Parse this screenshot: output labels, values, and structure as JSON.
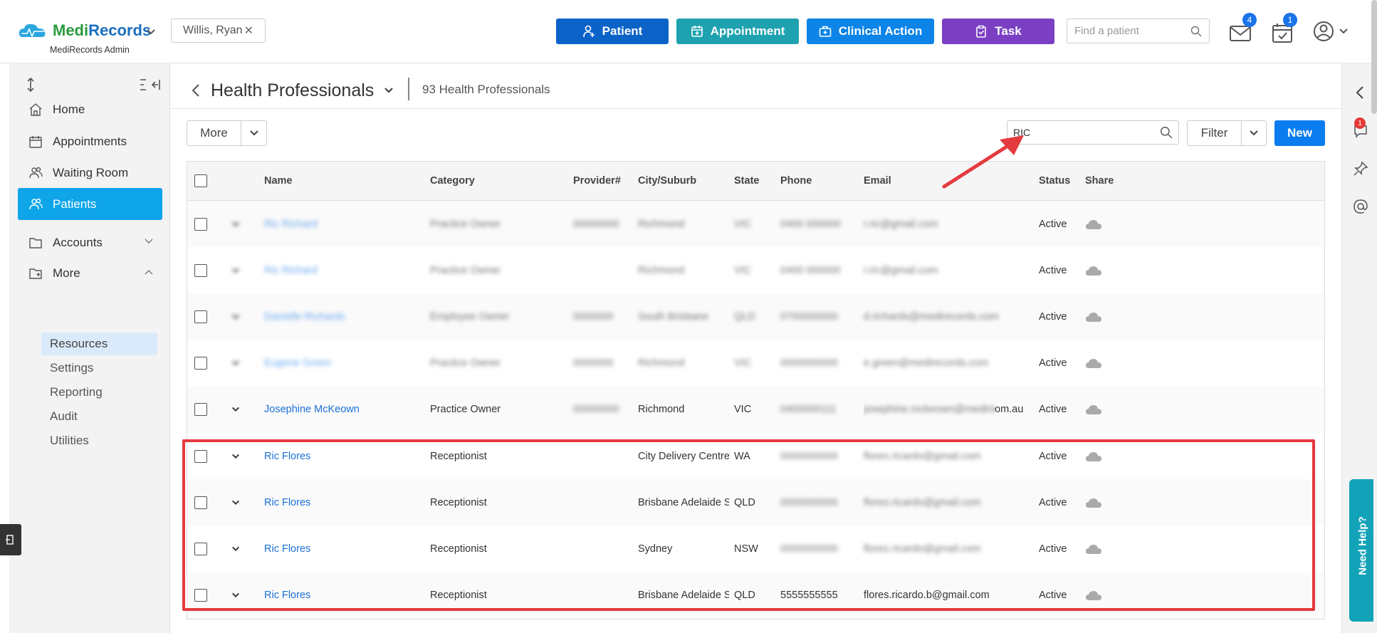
{
  "header": {
    "brand": "MediRecords",
    "brand_sub": "MediRecords Admin",
    "patient_chip": "Willis, Ryan",
    "buttons": {
      "patient": "Patient",
      "appointment": "Appointment",
      "clinical": "Clinical Action",
      "task": "Task"
    },
    "find_placeholder": "Find a patient",
    "mail_badge": "4",
    "tasks_badge": "1"
  },
  "sidebar": {
    "nav": [
      {
        "label": "Home",
        "icon": "home-icon"
      },
      {
        "label": "Appointments",
        "icon": "calendar-icon"
      },
      {
        "label": "Waiting Room",
        "icon": "users-icon"
      },
      {
        "label": "Patients",
        "icon": "patients-icon",
        "active": true
      },
      {
        "label": "Accounts",
        "icon": "folder-icon"
      },
      {
        "label": "More",
        "icon": "folder-plus-icon"
      }
    ],
    "more_items": [
      "Resources",
      "Settings",
      "Reporting",
      "Audit",
      "Utilities"
    ],
    "active_sub": "Resources"
  },
  "page": {
    "title": "Health Professionals",
    "count": "93 Health Professionals",
    "more_label": "More",
    "search_value": "RIC",
    "filter_label": "Filter",
    "new_label": "New"
  },
  "table": {
    "columns": [
      "Name",
      "Category",
      "Provider#",
      "City/Suburb",
      "State",
      "Phone",
      "Email",
      "Status",
      "Share"
    ],
    "rows": [
      {
        "name": "Ric Richard",
        "category": "Practice Owner",
        "provider": "00000000",
        "city": "Richmond",
        "state": "VIC",
        "phone": "0400 000000",
        "email": "r.ric@gmail.com",
        "status": "Active",
        "blurred": true
      },
      {
        "name": "Ric Richard",
        "category": "Practice Owner",
        "provider": "",
        "city": "Richmond",
        "state": "VIC",
        "phone": "0400 000000",
        "email": "r.ric@gmail.com",
        "status": "Active",
        "blurred": true
      },
      {
        "name": "Danielle Richards",
        "category": "Employee Owner",
        "provider": "0000000",
        "city": "South Brisbane",
        "state": "QLD",
        "phone": "0700000000",
        "email": "d.richards@medirecords.com",
        "status": "Active",
        "blurred": true
      },
      {
        "name": "Eugene Green",
        "category": "Practice Owner",
        "provider": "0000000",
        "city": "Richmond",
        "state": "VIC",
        "phone": "0000000000",
        "email": "e.green@medirecords.com",
        "status": "Active",
        "blurred": true
      },
      {
        "name": "Josephine McKeown",
        "category": "Practice Owner",
        "provider": "00000000",
        "city": "Richmond",
        "state": "VIC",
        "phone": "0400000111",
        "email": "josephine.mckeown@medirecordsgroup.com.au",
        "email_visible": "om.au",
        "status": "Active",
        "blurred": false,
        "blur_private": true
      },
      {
        "name": "Ric Flores",
        "category": "Receptionist",
        "provider": "",
        "city": "City Delivery Centre",
        "state": "WA",
        "phone": "0000000000",
        "email": "flores.ricardo@gmail.com",
        "status": "Active",
        "blurred": false,
        "blur_private": true
      },
      {
        "name": "Ric Flores",
        "category": "Receptionist",
        "provider": "",
        "city": "Brisbane Adelaide St...",
        "state": "QLD",
        "phone": "0000000000",
        "email": "flores.ricardo@gmail.com",
        "status": "Active",
        "blurred": false,
        "blur_private": true
      },
      {
        "name": "Ric Flores",
        "category": "Receptionist",
        "provider": "",
        "city": "Sydney",
        "state": "NSW",
        "phone": "0000000000",
        "email": "flores.ricardo@gmail.com",
        "status": "Active",
        "blurred": false,
        "blur_private": true
      },
      {
        "name": "Ric Flores",
        "category": "Receptionist",
        "provider": "",
        "city": "Brisbane Adelaide St...",
        "state": "QLD",
        "phone": "5555555555",
        "email": "flores.ricardo.b@gmail.com",
        "status": "Active",
        "blurred": false,
        "blur_private": false
      }
    ]
  },
  "rail": {
    "chat_badge": "1",
    "need_help": "Need Help?"
  },
  "colors": {
    "primary": "#0b63c8",
    "teal": "#1fa2b0",
    "blue": "#0c84e8",
    "purple": "#7b3fc4",
    "highlight": "#e53a3f",
    "active_nav": "#0ea5e9"
  }
}
